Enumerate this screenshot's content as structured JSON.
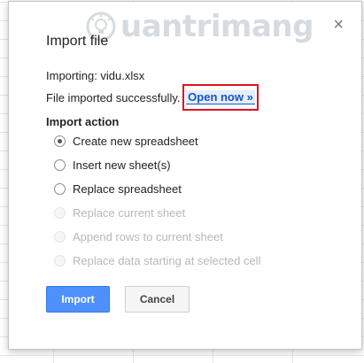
{
  "dialog": {
    "title": "Import file",
    "close_symbol": "×",
    "importing_text": "Importing: vidu.xlsx",
    "success_text": "File imported successfully.",
    "open_now_link": "Open now »",
    "section_heading": "Import action",
    "options": [
      {
        "label": "Create new spreadsheet",
        "checked": true,
        "enabled": true
      },
      {
        "label": "Insert new sheet(s)",
        "checked": false,
        "enabled": true
      },
      {
        "label": "Replace spreadsheet",
        "checked": false,
        "enabled": true
      },
      {
        "label": "Replace current sheet",
        "checked": false,
        "enabled": false
      },
      {
        "label": "Append rows to current sheet",
        "checked": false,
        "enabled": false
      },
      {
        "label": "Replace data starting at selected cell",
        "checked": false,
        "enabled": false
      }
    ],
    "import_button": "Import",
    "cancel_button": "Cancel"
  },
  "watermark": {
    "text": "uantrimang",
    "color": "#8a9aa8"
  },
  "colors": {
    "primary_button": "#4d90fe",
    "link": "#1155cc",
    "highlight_box": "#e0131b"
  }
}
